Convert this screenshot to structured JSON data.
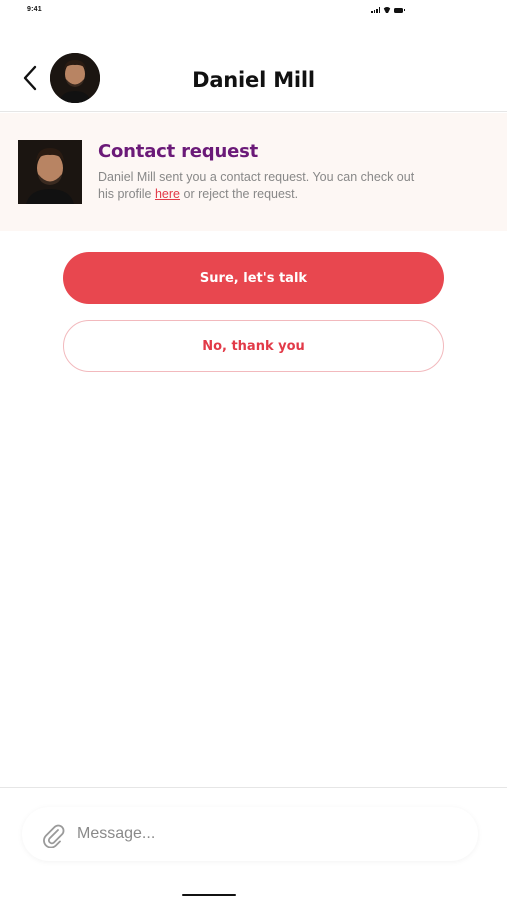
{
  "status_bar": {
    "time": "9:41"
  },
  "header": {
    "title": "Daniel Mill"
  },
  "request": {
    "title": "Contact request",
    "text_before_link": "Daniel Mill sent you a contact request. You can check out his profile ",
    "link_text": "here",
    "text_after_link": " or reject the request."
  },
  "actions": {
    "accept_label": "Sure, let's talk",
    "decline_label": "No, thank you"
  },
  "composer": {
    "placeholder": "Message..."
  },
  "colors": {
    "accent": "#e8474f",
    "title_purple": "#6b1a78",
    "card_background": "#fdf7f4"
  },
  "icons": [
    "back-arrow-icon",
    "paperclip-icon"
  ]
}
